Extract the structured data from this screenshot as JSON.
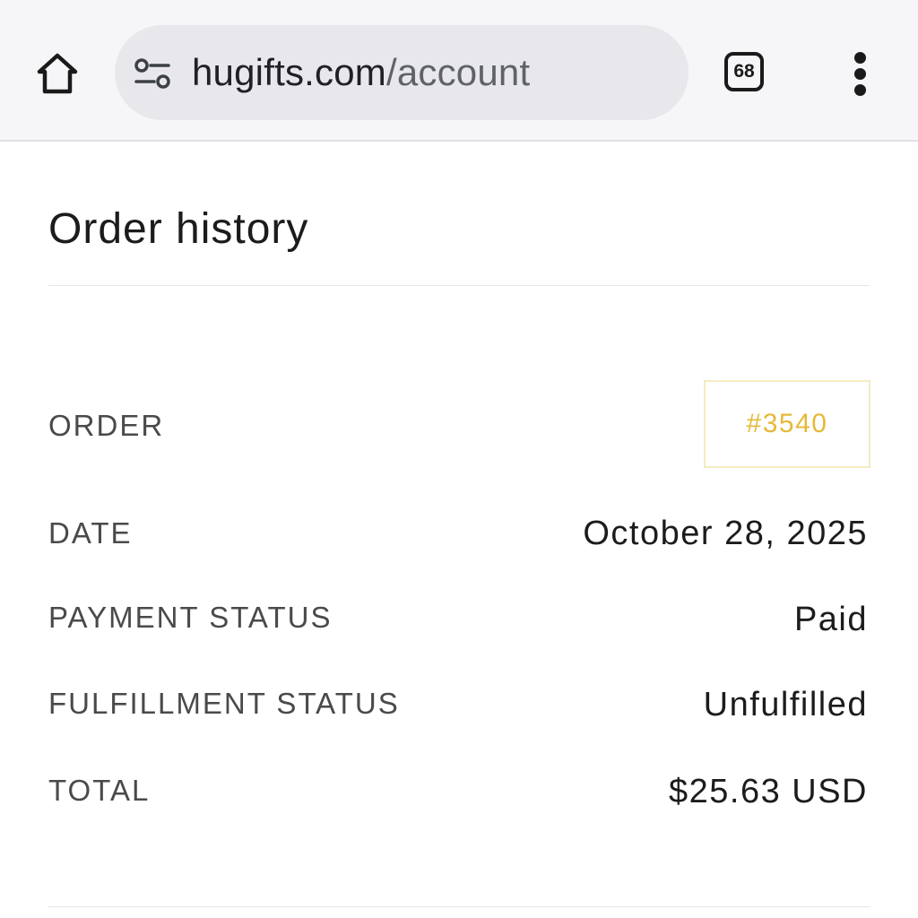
{
  "browser": {
    "url_host": "hugifts.com",
    "url_path": "/account",
    "tab_count": "68"
  },
  "page": {
    "title": "Order history"
  },
  "order": {
    "order_label": "ORDER",
    "order_number": "#3540",
    "date_label": "DATE",
    "date_value": "October 28, 2025",
    "payment_label": "PAYMENT STATUS",
    "payment_value": "Paid",
    "fulfillment_label": "FULFILLMENT STATUS",
    "fulfillment_value": "Unfulfilled",
    "total_label": "TOTAL",
    "total_value": "$25.63 USD"
  },
  "colors": {
    "accent": "#e6b93a",
    "toolbar_bg": "#f6f6f8",
    "urlbar_bg": "#e8e8ec"
  },
  "icons": {
    "home": "home-icon",
    "site_settings": "tune-icon",
    "tabs": "tab-switcher-icon",
    "menu": "more-vert-icon"
  }
}
